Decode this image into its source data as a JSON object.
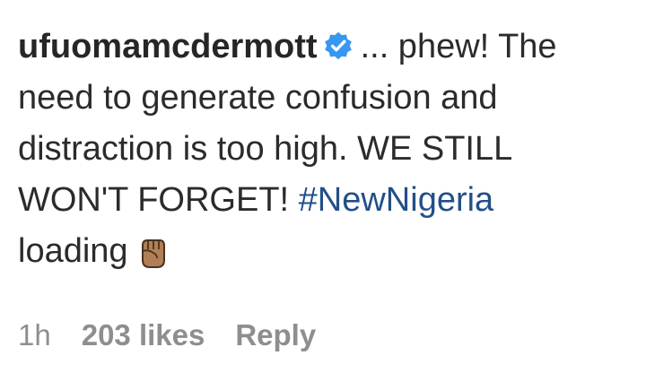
{
  "comment": {
    "username": "ufuomamcdermott",
    "verified_icon": "verified-badge-icon",
    "text_before_hashtag": "... phew! The need to generate confusion and distraction is too high. WE STILL WON'T FORGET!",
    "hashtag": "#NewNigeria",
    "text_after_hashtag": "loading",
    "emoji_icon": "raised-fist-icon"
  },
  "meta": {
    "time": "1h",
    "likes": "203 likes",
    "reply_label": "Reply"
  },
  "colors": {
    "verified_blue": "#3897f0",
    "hashtag": "#224f88",
    "meta_gray": "#8e8e8e",
    "fist_skin": "#b07f56"
  }
}
